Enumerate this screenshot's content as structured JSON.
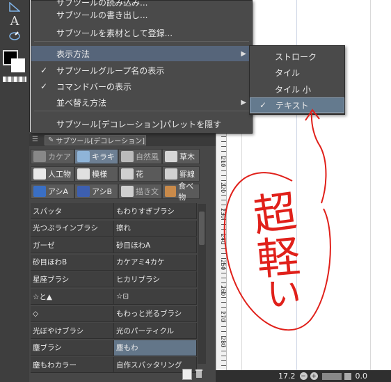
{
  "tools": [
    "ruler-icon",
    "text-icon",
    "balloon-icon",
    "color-swatch"
  ],
  "tool_text": "A",
  "menu": {
    "items": [
      {
        "label": "サブツールの読み込み...",
        "checked": false,
        "submenu": false
      },
      {
        "label": "サブツールの書き出し...",
        "checked": false,
        "submenu": false
      },
      {
        "label": "サブツールを素材として登録...",
        "checked": false,
        "submenu": false
      },
      {
        "label": "表示方法",
        "checked": false,
        "submenu": true,
        "highlighted": true
      },
      {
        "label": "サブツールグループ名の表示",
        "checked": true,
        "submenu": false
      },
      {
        "label": "コマンドバーの表示",
        "checked": true,
        "submenu": false
      },
      {
        "label": "並べ替え方法",
        "checked": false,
        "submenu": true
      },
      {
        "label": "サブツール[デコレーション]パレットを隠す",
        "checked": false,
        "submenu": false
      }
    ]
  },
  "submenu": {
    "items": [
      {
        "label": "ストローク",
        "checked": false
      },
      {
        "label": "タイル",
        "checked": false
      },
      {
        "label": "タイル 小",
        "checked": false
      },
      {
        "label": "テキスト",
        "checked": true
      }
    ]
  },
  "palette": {
    "tab_label": "サブツール[デコレーション]",
    "groups": [
      {
        "label": "カケア",
        "dim": true
      },
      {
        "label": "キラキ",
        "active": true
      },
      {
        "label": "自然風",
        "dim": true
      },
      {
        "label": "草木"
      },
      {
        "label": "人工物"
      },
      {
        "label": "模様"
      },
      {
        "label": "花"
      },
      {
        "label": "罫線"
      },
      {
        "label": "アシA"
      },
      {
        "label": "アシB"
      },
      {
        "label": "描き文",
        "dim": true
      },
      {
        "label": "食べ物"
      }
    ],
    "left_items": [
      "スパッタ",
      "光つぶラインブラシ",
      "ガーゼ",
      "砂目ほわB",
      "星座ブラシ",
      "☆と▲",
      "◇",
      "光ぼやけブラシ",
      "塵ブラシ",
      "塵もわカラー"
    ],
    "right_items": [
      "もわりすぎブラシ",
      "擦れ",
      "砂目ほわA",
      "カケアミ4カケ",
      "ヒカリブラシ",
      "☆⊡",
      "もわっと光るブラシ",
      "光のパーティクル",
      "塵もわ",
      "自作スパッタリング"
    ],
    "selected_right": 8
  },
  "ruler": {
    "labels": [
      "210",
      "220",
      "230",
      "240",
      "250",
      "260",
      "270",
      "280"
    ]
  },
  "status": {
    "zoom": "17.2",
    "value": "0.0"
  },
  "annotation": {
    "text": "超軽い",
    "color": "#e0201a"
  }
}
